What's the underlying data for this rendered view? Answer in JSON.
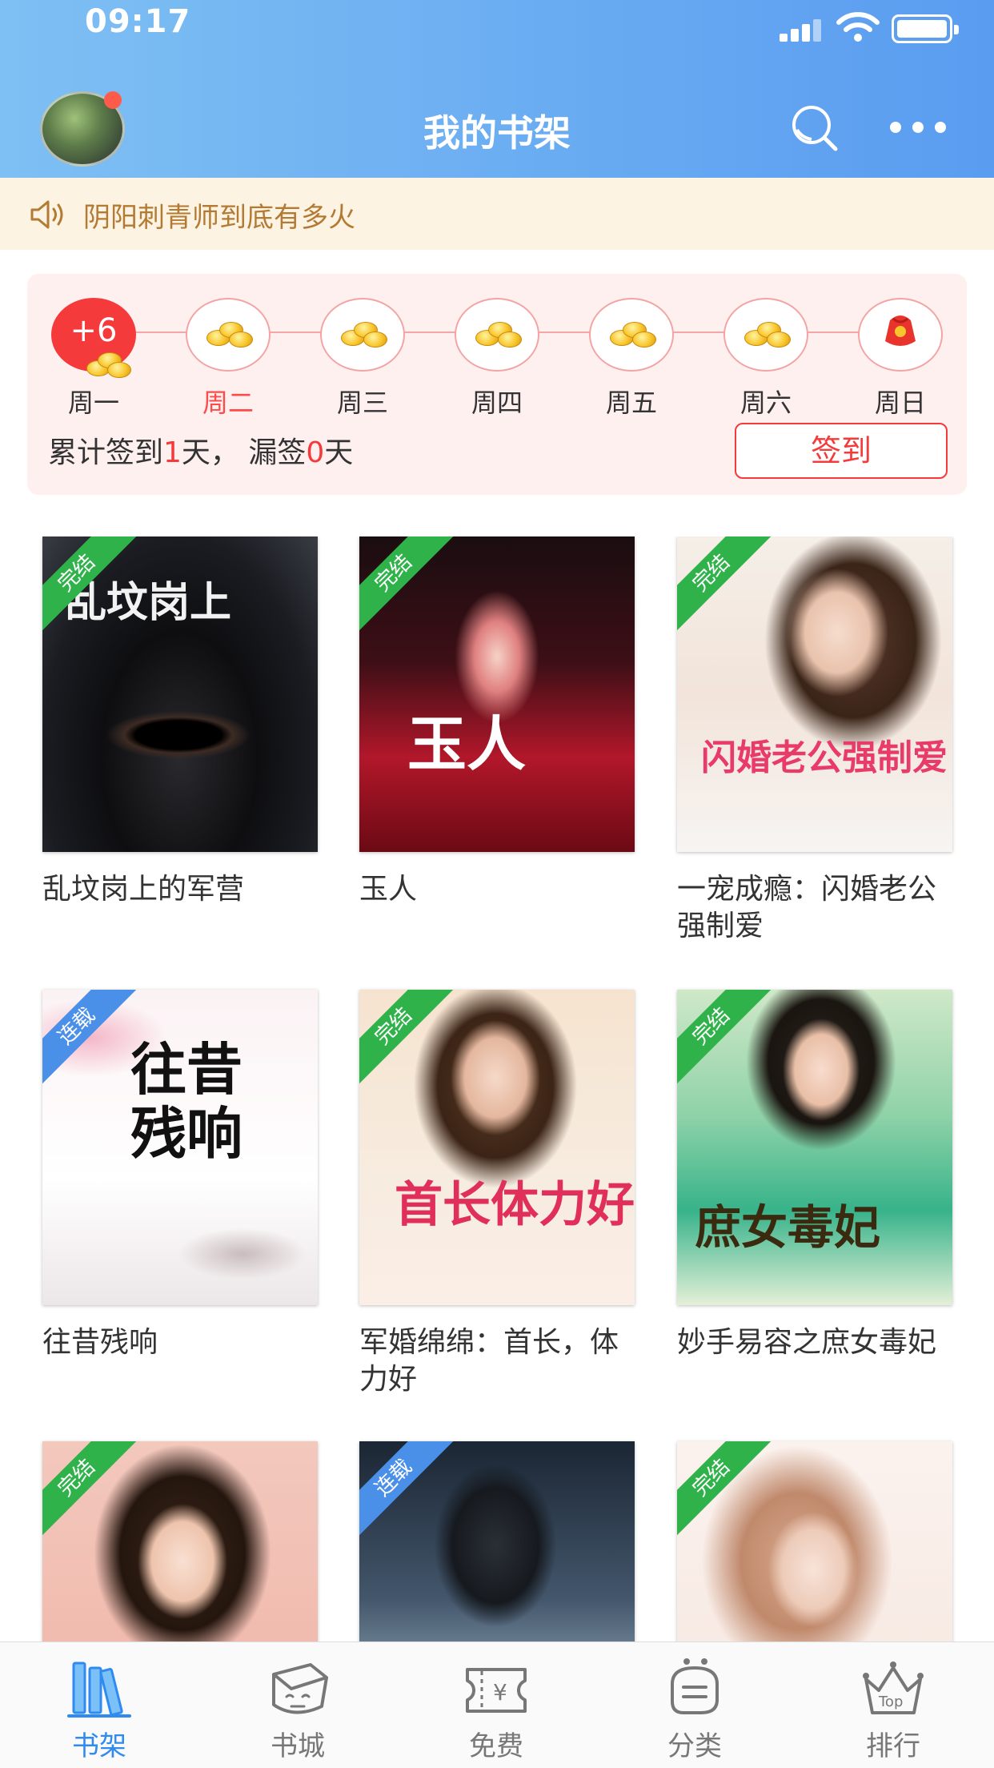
{
  "status_bar": {
    "time": "09:17"
  },
  "header": {
    "title": "我的书架"
  },
  "notice": {
    "text": "阴阳刺青师到底有多火"
  },
  "checkin": {
    "days": [
      {
        "label": "周一",
        "state": "today",
        "bonus": "+6"
      },
      {
        "label": "周二",
        "state": "active"
      },
      {
        "label": "周三",
        "state": "normal"
      },
      {
        "label": "周四",
        "state": "normal"
      },
      {
        "label": "周五",
        "state": "normal"
      },
      {
        "label": "周六",
        "state": "normal"
      },
      {
        "label": "周日",
        "state": "gift"
      }
    ],
    "summary_prefix": "累计签到",
    "days_signed": "1",
    "summary_mid": "天，  漏签",
    "days_missed": "0",
    "summary_suffix": "天",
    "button_label": "签到"
  },
  "books": [
    {
      "title": "乱坟岗上的军营",
      "status": "完结",
      "cover_text": "乱坟岗上"
    },
    {
      "title": "玉人",
      "status": "完结",
      "cover_text": "玉人"
    },
    {
      "title": "一宠成瘾：闪婚老公强制爱",
      "status": "完结",
      "cover_text": "闪婚老公强制爱"
    },
    {
      "title": "往昔残响",
      "status": "连载",
      "cover_text": "往昔残响"
    },
    {
      "title": "军婚绵绵：首长，体力好",
      "status": "完结",
      "cover_text": "首长体力好"
    },
    {
      "title": "妙手易容之庶女毒妃",
      "status": "完结",
      "cover_text": "庶女毒妃"
    },
    {
      "title": "",
      "status": "完结",
      "cover_text": ""
    },
    {
      "title": "",
      "status": "连载",
      "cover_text": ""
    },
    {
      "title": "",
      "status": "完结",
      "cover_text": ""
    }
  ],
  "tabbar": {
    "tabs": [
      {
        "label": "书架",
        "icon": "bookshelf-icon",
        "active": true
      },
      {
        "label": "书城",
        "icon": "bookstore-icon",
        "active": false
      },
      {
        "label": "免费",
        "icon": "free-ticket-icon",
        "active": false
      },
      {
        "label": "分类",
        "icon": "category-icon",
        "active": false
      },
      {
        "label": "排行",
        "icon": "ranking-crown-icon",
        "active": false
      }
    ],
    "rank_icon_text": "Top"
  },
  "colors": {
    "accent_blue": "#2f8bf0",
    "header_gradient_start": "#7ec0f3",
    "header_gradient_end": "#5a9cf0",
    "checkin_red": "#f43a3a",
    "ribbon_done": "#2fb24a",
    "ribbon_serial": "#4a8fe8",
    "notice_text": "#b37a33"
  }
}
